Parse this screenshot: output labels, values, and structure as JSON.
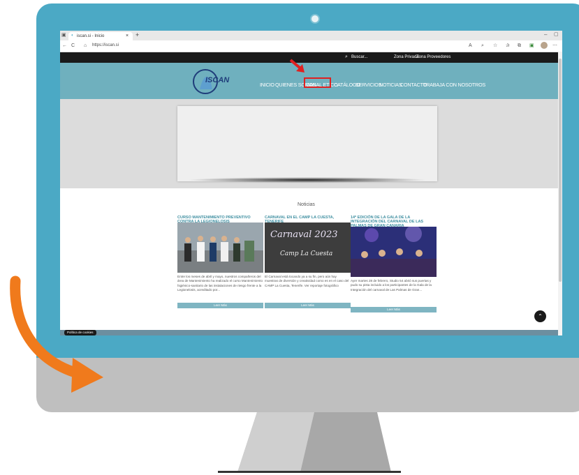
{
  "browser": {
    "tab_title": "iscan.si - Inicio",
    "address": "https://iscan.si",
    "add_tab": "+",
    "nav_back": "←",
    "nav_reload": "C"
  },
  "site": {
    "search_label": "Buscar...",
    "top_links": [
      "Zona Privada",
      "Zona Proveedores"
    ],
    "logo_text": "ISCAN",
    "nav_items": [
      "INICIO",
      "QUIENES SOMOS",
      "CANAL ETICO",
      "CATÁLOGO",
      "SERVICIOS",
      "NOTICIAS",
      "CONTACTO",
      "TRABAJA CON NOSOTROS"
    ],
    "news_heading": "Noticias",
    "cards": [
      {
        "title": "CURSO MANTENIMIENTO PREVENTIVO CONTRA LA LEGIONELOSIS",
        "text": "Entre los meses de abril y mayo, nuestros compañeros del área de Mantenimiento ha realizado el curso Mantenimiento higiénico-sanitario de las instalaciones de riesgo frente a la Legionelosis, acreditado por...",
        "button": "Leer Más"
      },
      {
        "title": "CARNAVAL EN EL CAMP LA CUESTA, TENERIFE",
        "text": "El Carnaval está tocando ya a su fin, pero aún hay muestras de diversión y creatividad como es en el caso del CAMP La Cuesta, Tenerife. Ver reportaje fotográfico",
        "button": "Leer Más",
        "image_text": [
          "Carnaval 2023",
          "Camp La Cuesta"
        ]
      },
      {
        "title": "14º EDICIÓN DE LA GALA DE LA INTEGRACIÓN DEL CARNAVAL DE LAS PALMAS DE GRAN CANARIA",
        "text": "Ayer martes 28 de febrero, Studio 54 abrió sus puertas y pudo su pista incluido a los participantes de la Gala de la Integración del carnaval de Las Palmas de Gran...",
        "button": "Leer Más"
      }
    ],
    "cookie_label": "Política de cookies"
  },
  "colors": {
    "bezel": "#4ba9c5",
    "header": "#6fb0be",
    "accent_arrow": "#f07a1c",
    "highlight": "#e02020"
  }
}
